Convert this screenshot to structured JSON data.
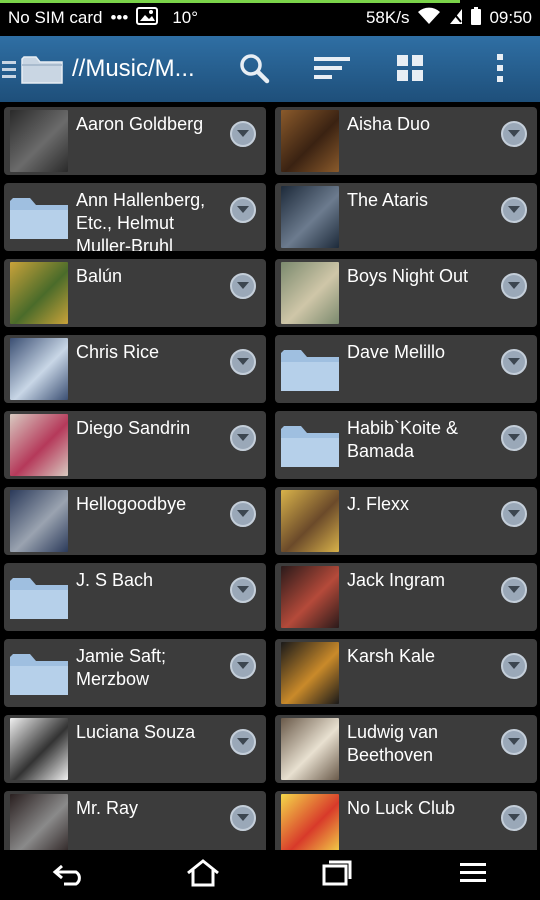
{
  "status_bar": {
    "carrier": "No SIM card",
    "dots": "•••",
    "temperature": "10°",
    "net_speed": "58K/s",
    "time": "09:50",
    "icons": [
      "gallery-icon",
      "wifi-icon",
      "signal-icon",
      "battery-icon"
    ]
  },
  "action_bar": {
    "path": "//Music/M...",
    "icons": [
      "folder-icon",
      "search-icon",
      "sort-icon",
      "grid-view-icon",
      "overflow-menu-icon"
    ]
  },
  "colors": {
    "action_bar": "#2a6597",
    "tile": "#3c3c3c",
    "folder": "#9fbfe0",
    "expand_button": "#9aa8b8"
  },
  "artists": [
    {
      "name": "Aaron Goldberg",
      "thumb": "photo"
    },
    {
      "name": "Aisha Duo",
      "thumb": "photo"
    },
    {
      "name": "Ann Hallenberg, Etc., Helmut Muller-Bruhl",
      "thumb": "folder"
    },
    {
      "name": "The Ataris",
      "thumb": "photo"
    },
    {
      "name": "Balún",
      "thumb": "photo"
    },
    {
      "name": "Boys Night Out",
      "thumb": "photo"
    },
    {
      "name": "Chris Rice",
      "thumb": "photo"
    },
    {
      "name": "Dave Melillo",
      "thumb": "folder"
    },
    {
      "name": "Diego Sandrin",
      "thumb": "photo"
    },
    {
      "name": "Habib`Koite & Bamada",
      "thumb": "folder"
    },
    {
      "name": "Hellogoodbye",
      "thumb": "photo"
    },
    {
      "name": "J. Flexx",
      "thumb": "photo"
    },
    {
      "name": "J. S Bach",
      "thumb": "folder"
    },
    {
      "name": "Jack Ingram",
      "thumb": "photo"
    },
    {
      "name": "Jamie Saft; Merzbow",
      "thumb": "folder"
    },
    {
      "name": "Karsh Kale",
      "thumb": "photo"
    },
    {
      "name": "Luciana Souza",
      "thumb": "photo"
    },
    {
      "name": "Ludwig van Beethoven",
      "thumb": "photo"
    },
    {
      "name": "Mr. Ray",
      "thumb": "photo"
    },
    {
      "name": "No Luck Club",
      "thumb": "photo"
    }
  ],
  "nav_bar": {
    "icons": [
      "back-icon",
      "home-icon",
      "recent-apps-icon",
      "menu-icon"
    ]
  }
}
